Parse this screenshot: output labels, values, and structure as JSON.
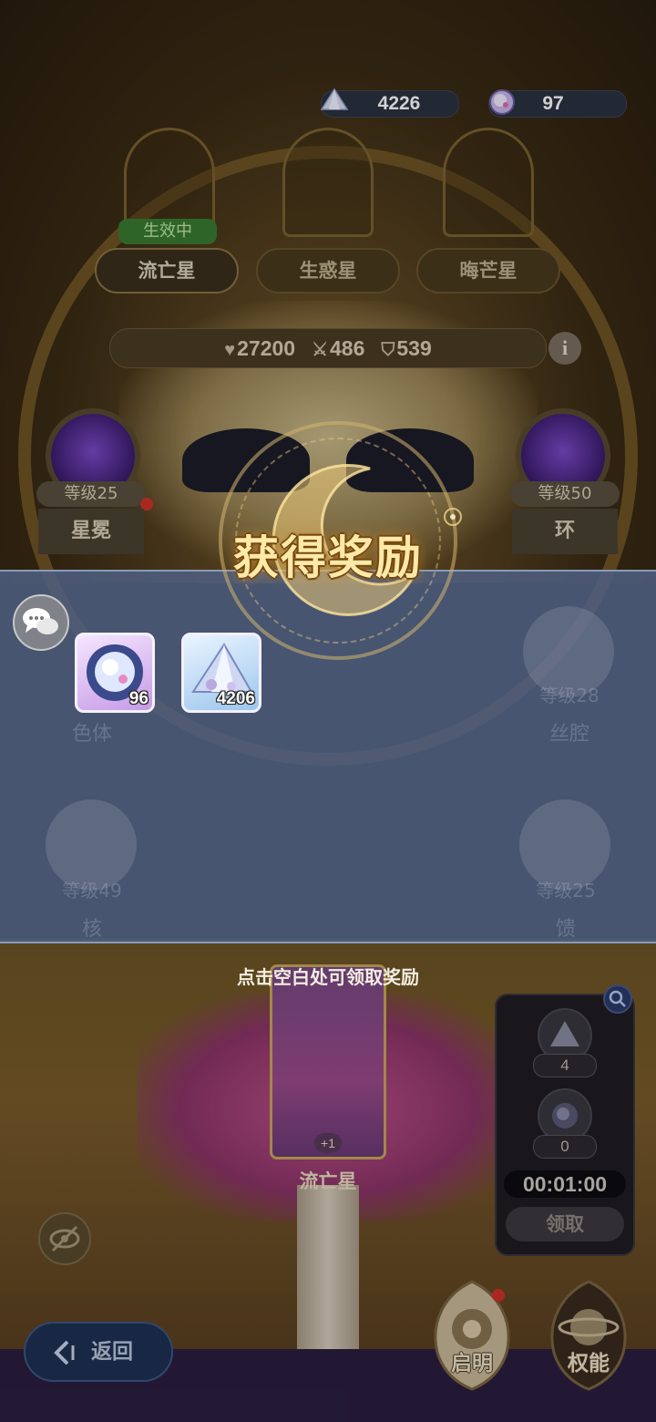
{
  "currencies": [
    {
      "icon": "crystal-icon",
      "value": "4226"
    },
    {
      "icon": "orb-icon",
      "value": "97"
    }
  ],
  "star_tabs": [
    {
      "label": "流亡星",
      "active": true
    },
    {
      "label": "生惑星",
      "active": false
    },
    {
      "label": "晦芒星",
      "active": false
    }
  ],
  "active_badge": "生效中",
  "stats": {
    "hp": "27200",
    "atk": "486",
    "def": "539"
  },
  "nodes": {
    "left_top": {
      "level": "等级25",
      "name": "星冕"
    },
    "right_top": {
      "level": "等级50",
      "name": "环"
    },
    "left_mid": {
      "name": "色体"
    },
    "right_mid": {
      "level": "等级28",
      "name": "丝腔"
    },
    "left_bottom": {
      "level": "等级49",
      "name": "核"
    },
    "right_bottom": {
      "level": "等级25",
      "name": "馈"
    }
  },
  "reward": {
    "title": "获得奖励",
    "items": [
      {
        "icon": "moon-orb-icon",
        "quantity": "96"
      },
      {
        "icon": "crystal-shard-icon",
        "quantity": "4206"
      }
    ],
    "hint": "点击空白处可领取奖励"
  },
  "card": {
    "badge": "+1",
    "label": "流亡星"
  },
  "side_panel": {
    "counts": [
      "4",
      "0"
    ],
    "timer": "00:01:00",
    "claim_label": "领取"
  },
  "bottom_nav": {
    "back_label": "返回",
    "enlighten_label": "启明",
    "authority_label": "权能"
  },
  "colors": {
    "overlay": "#4e5e80",
    "title_gold": "#ffe9a8",
    "badge_green": "#3a7a32"
  }
}
